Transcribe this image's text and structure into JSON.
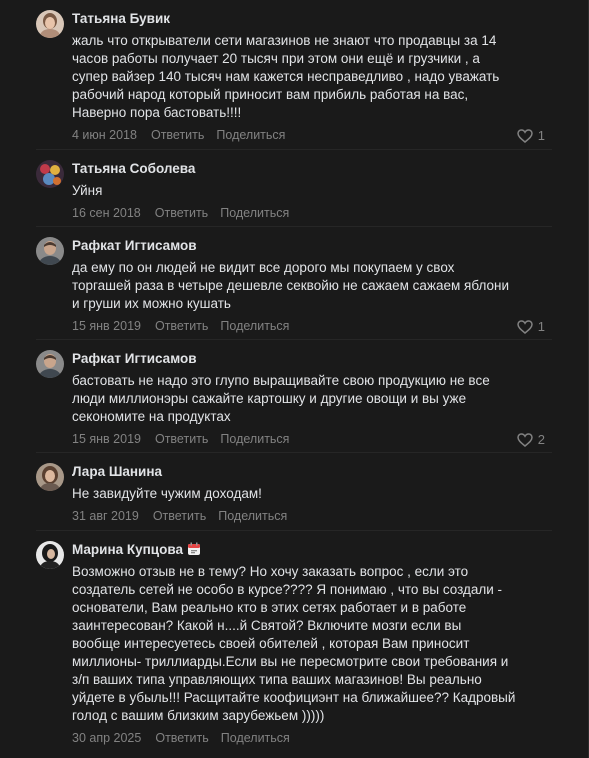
{
  "colors": {
    "background": "#1a1a1a",
    "text_primary": "#e1e3e6",
    "text_secondary": "#828282"
  },
  "actions": {
    "reply_label": "Ответить",
    "share_label": "Поделиться"
  },
  "comments": [
    {
      "author": "Татьяна Бувик",
      "text": "жаль что открыватели сети магазинов не знают что продавцы за 14\nчасов работы получает 20 тысяч при этом они ещё и грузчики , а\nсупер вайзер 140 тысяч нам кажется несправедливо , надо уважать\nрабочий народ который приносит вам прибиль работая на вас,\nНаверно пора бастовать!!!!",
      "date": "4 июн 2018",
      "likes": "1",
      "avatar_icon": "woman-photo-avatar-icon"
    },
    {
      "author": "Татьяна Соболева",
      "text": "Уйня",
      "date": "16 сен 2018",
      "likes": "",
      "avatar_icon": "colorful-photo-avatar-icon"
    },
    {
      "author": "Рафкат Игтисамов",
      "text": "да ему по он людей не видит все дорого мы покупаем у свох\nторгашей раза в четыре дешевле секвойю не сажаем сажаем яблони\nи груши их можно кушать",
      "date": "15 янв 2019",
      "likes": "1",
      "avatar_icon": "man-photo-avatar-icon"
    },
    {
      "author": "Рафкат Игтисамов",
      "text": "бастовать не надо это глупо выращивайте свою продукцию не все\nлюди миллионэры сажайте картошку и другие овощи и вы уже\nсекономите на продуктах",
      "date": "15 янв 2019",
      "likes": "2",
      "avatar_icon": "man-photo-avatar-icon"
    },
    {
      "author": "Лара Шанина",
      "text": "Не завидуйте чужим доходам!",
      "date": "31 авг 2019",
      "likes": "",
      "avatar_icon": "woman-photo-avatar-icon"
    },
    {
      "author": "Марина Купцова",
      "badge_icon": "calendar-badge-icon",
      "text": "Возможно отзыв не в тему? Но хочу заказать вопрос , если это\nсоздатель сетей не особо в курсе???? Я понимаю , что вы создали -\nоснователи, Вам реально кто в этих сетях работает и в работе\nзаинтересован? Какой н....й Святой? Включите мозги если вы\nвообще интересуетесь своей обителей , которая Вам приносит\nмиллионы- триллиарды.Если вы не пересмотрите свои требования и\nз/п ваших типа управляющих типа ваших магазинов! Вы реально\nуйдете в убыль!!! Расщитайте коофициэнт на ближайшее?? Кадровый\nголод с вашим близким зарубежьем )))))",
      "date": "30 апр 2025",
      "likes": "",
      "avatar_icon": "dark-photo-avatar-icon"
    }
  ]
}
